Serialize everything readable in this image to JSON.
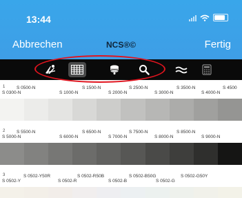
{
  "status": {
    "time": "13:44"
  },
  "nav": {
    "left": "Abbrechen",
    "title": "NCS®©",
    "right": "Fertig"
  },
  "toolbar": {
    "items": [
      {
        "icon": "palette-icon",
        "active": false
      },
      {
        "icon": "grid-table-icon",
        "active": true
      },
      {
        "icon": "color-fan-icon",
        "active": false
      },
      {
        "icon": "search-icon",
        "active": false
      },
      {
        "icon": "approx-equal-icon",
        "active": false
      },
      {
        "icon": "calculator-icon",
        "active": false
      }
    ]
  },
  "sections": [
    {
      "index": "1",
      "labels_top": [
        "S 0500-N",
        "S 1500-N",
        "S 2500-N",
        "S 3500-N",
        "S 4500"
      ],
      "labels_bottom": [
        "S 0300-N",
        "S 1000-N",
        "S 2000-N",
        "S 3000-N",
        "S 4000-N"
      ],
      "swatches": [
        "#f3f3f1",
        "#ececea",
        "#e4e4e2",
        "#d8d8d6",
        "#cdcdcb",
        "#c1c1bf",
        "#b7b7b5",
        "#acacaa",
        "#a0a09e",
        "#959593"
      ]
    },
    {
      "index": "2",
      "labels_top": [
        "S 5500-N",
        "S 6500-N",
        "S 7500-N",
        "S 8500-N"
      ],
      "labels_bottom": [
        "S 5000-N",
        "S 6000-N",
        "S 7000-N",
        "S 8000-N",
        "S 9000-N"
      ],
      "swatches": [
        "#8c8c8a",
        "#828280",
        "#777775",
        "#6c6c6a",
        "#626260",
        "#575755",
        "#4a4a48",
        "#3e3e3c",
        "#2f2f2d",
        "#151514"
      ]
    },
    {
      "index": "3",
      "labels_top": [
        "S 0502-Y50R",
        "S 0502-R50B",
        "S 0502-B50G",
        "S 0502-G50Y"
      ],
      "labels_bottom": [
        "S 0502-Y",
        "S 0502-R",
        "S 0502-B",
        "S 0502-G"
      ],
      "swatches": [
        "#f4f1e9",
        "#f3efe8",
        "#f2ede9",
        "#f1eeee",
        "#eeeef1",
        "#ecf0f2",
        "#ecf1ef",
        "#eef1ec",
        "#f1f1ea",
        "#f3f2e8"
      ]
    }
  ]
}
